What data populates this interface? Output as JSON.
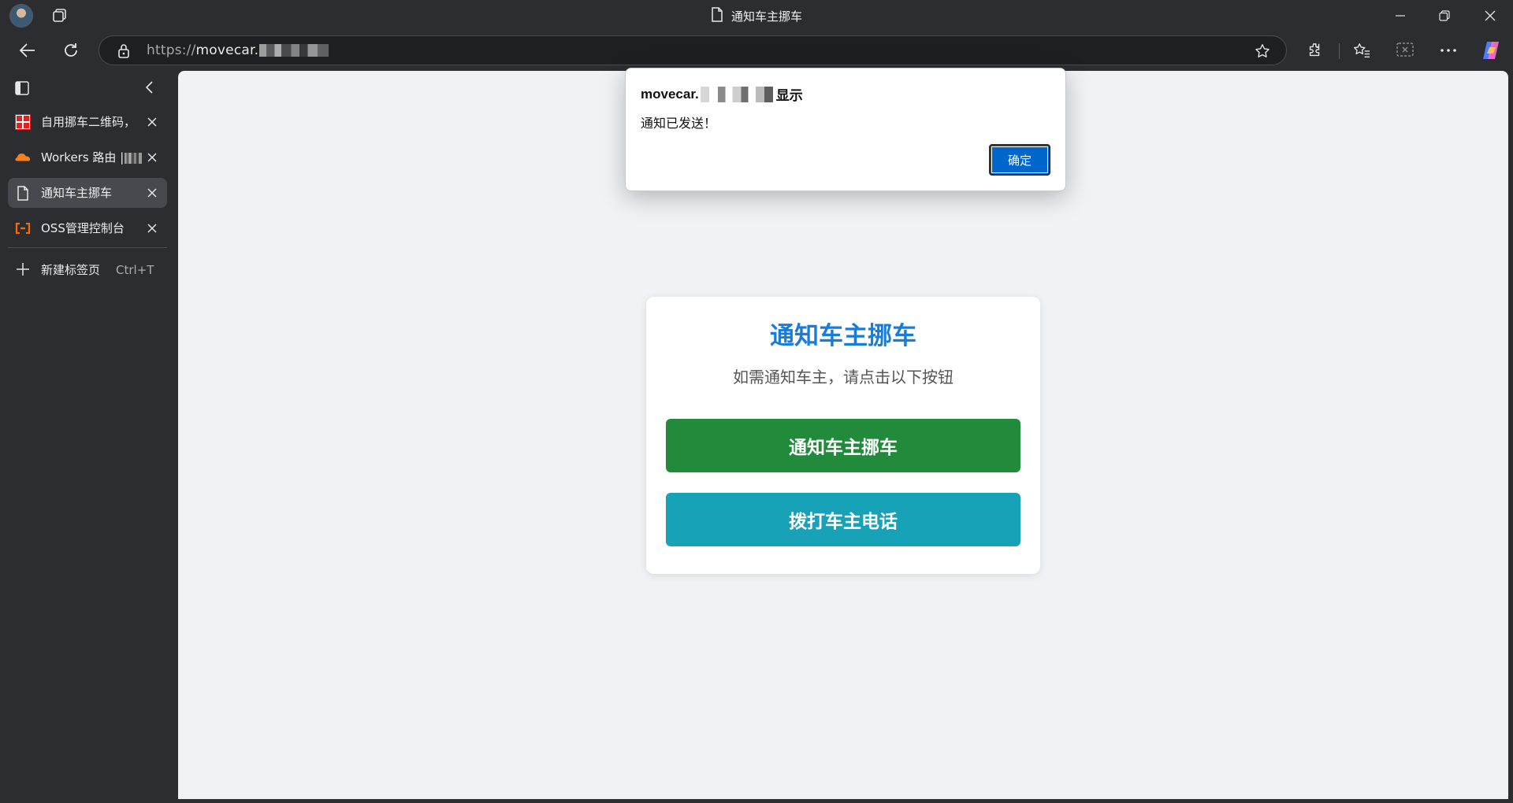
{
  "window": {
    "title": "通知车主挪车",
    "minimize": "—",
    "restore": "❐",
    "close": "✕"
  },
  "address_bar": {
    "url_scheme": "https://",
    "url_host": "movecar."
  },
  "sidebar": {
    "tabs": [
      {
        "label": "自用挪车二维码，",
        "favicon": "red-stamp-icon",
        "active": false
      },
      {
        "label": "Workers 路由 |",
        "favicon": "cloudflare-icon",
        "active": false
      },
      {
        "label": "通知车主挪车",
        "favicon": "document-icon",
        "active": true
      },
      {
        "label": "OSS管理控制台",
        "favicon": "aliyun-icon",
        "active": false
      }
    ],
    "new_tab_label": "新建标签页",
    "new_tab_shortcut": "Ctrl+T"
  },
  "dialog": {
    "title_prefix": "movecar.",
    "title_suffix": "显示",
    "message": "通知已发送！",
    "ok_label": "确定"
  },
  "card": {
    "title": "通知车主挪车",
    "subtitle": "如需通知车主，请点击以下按钮",
    "notify_button": "通知车主挪车",
    "call_button": "拨打车主电话"
  },
  "colors": {
    "title_blue": "#1a7cd9",
    "notify_green": "#228b3b",
    "call_teal": "#17a2b8",
    "dialog_ok_blue": "#0066cc"
  }
}
